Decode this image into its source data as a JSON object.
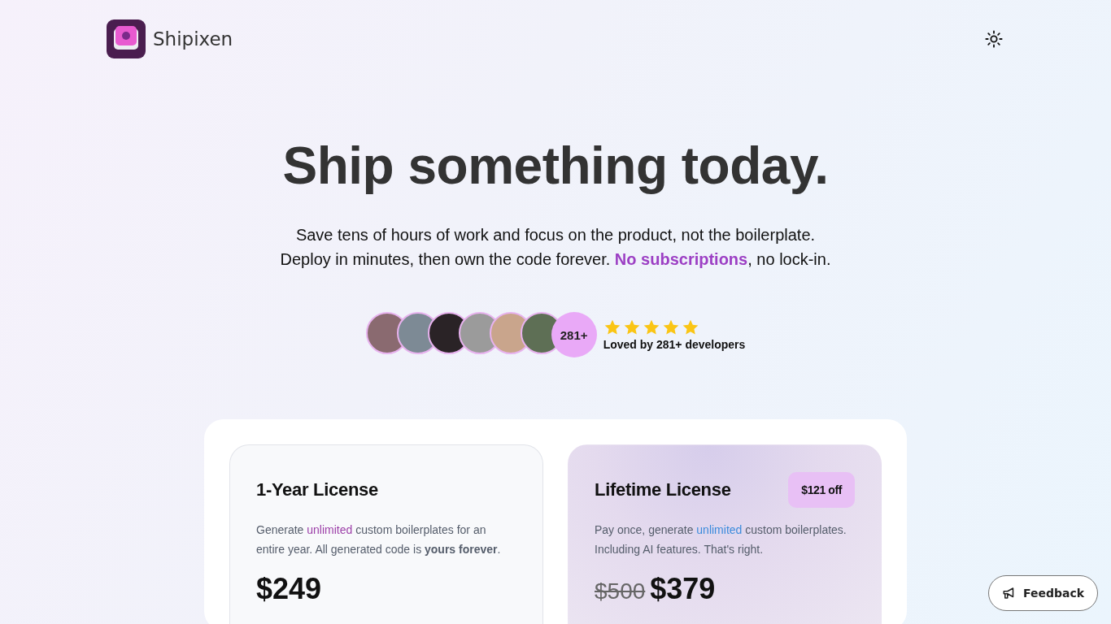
{
  "header": {
    "logo_text": "Shipixen"
  },
  "hero": {
    "title": "Ship something today.",
    "subtitle_lines": [
      "Save tens of hours of work and focus on the product, not the boilerplate.",
      "Deploy in minutes, then own the code forever. **No subscriptions**, no lock-in."
    ]
  },
  "social_proof": {
    "count_badge": "281+",
    "stars": 5,
    "caption": "Loved by 281+ developers"
  },
  "plans": [
    {
      "kind": "standard",
      "title": "1-Year License",
      "description": [
        {
          "kind": "plain",
          "text": "Generate "
        },
        {
          "kind": "highlight",
          "text": "unlimited"
        },
        {
          "kind": "plain",
          "text": " custom boilerplates for an entire year. All generated code is "
        },
        {
          "kind": "bold",
          "text": "yours forever"
        },
        {
          "kind": "plain",
          "text": "."
        }
      ],
      "price": "$249"
    },
    {
      "kind": "featured",
      "title": "Lifetime License",
      "badge": "$121 off",
      "description": [
        {
          "kind": "plain",
          "text": "Pay once, generate "
        },
        {
          "kind": "highlight",
          "text": "unlimited"
        },
        {
          "kind": "plain",
          "text": " custom boilerplates. Including AI features. That's right."
        }
      ],
      "old_price": "$500",
      "price": "$379"
    }
  ],
  "feedback_button": {
    "label": "Feedback"
  }
}
